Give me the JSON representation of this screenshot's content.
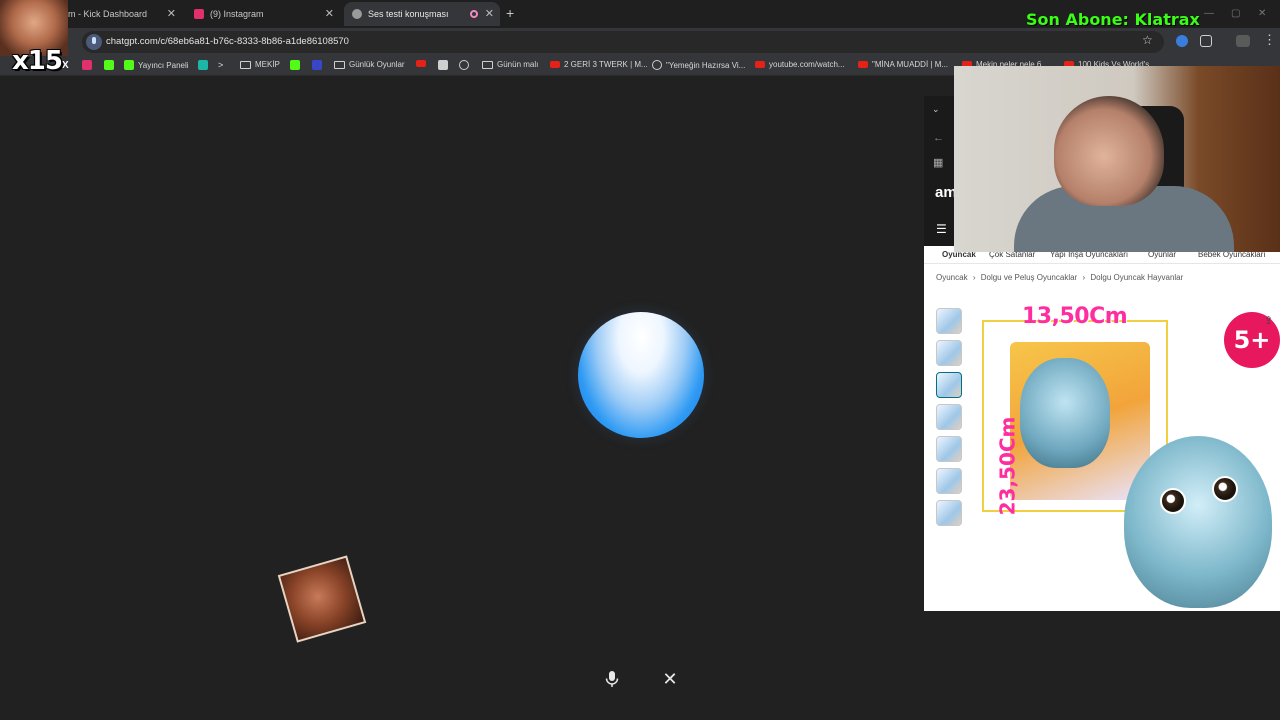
{
  "browser": {
    "tabs": [
      {
        "title": "m - Kick Dashboard",
        "favicon_color": "#53fc18"
      },
      {
        "title": "(9) Instagram",
        "favicon_color": "#e1306c"
      },
      {
        "title": "Ses testi konuşması",
        "favicon_color": "#bbbbbb"
      }
    ],
    "url": "chatgpt.com/c/68eb6a81-b76c-8333-8b86-a1de86108570",
    "bookmarks": [
      {
        "label": "",
        "icon": "x-icon"
      },
      {
        "label": "",
        "icon": "instagram-icon"
      },
      {
        "label": "",
        "icon": "kick-icon"
      },
      {
        "label": "Yayıncı Paneli",
        "icon": "kick-icon"
      },
      {
        "label": "",
        "icon": "app-icon"
      },
      {
        "label": "",
        "icon": "terminal-icon"
      },
      {
        "label": "MEKİP",
        "icon": "folder-icon"
      },
      {
        "label": "",
        "icon": "kick-icon"
      },
      {
        "label": "",
        "icon": "app-icon"
      },
      {
        "label": "Günlük Oyunlar",
        "icon": "folder-icon"
      },
      {
        "label": "",
        "icon": "youtube-icon"
      },
      {
        "label": "",
        "icon": "image-icon"
      },
      {
        "label": "",
        "icon": "globe-icon"
      },
      {
        "label": "Günün malı",
        "icon": "folder-icon"
      },
      {
        "label": "2 GERİ 3 TWERK | M...",
        "icon": "youtube-icon"
      },
      {
        "label": "\"Yemeğin Hazırsa Vi...",
        "icon": "globe-icon"
      },
      {
        "label": "youtube.com/watch...",
        "icon": "youtube-icon"
      },
      {
        "label": "\"MİNA MUADDİ | M...",
        "icon": "youtube-icon"
      },
      {
        "label": "Mekin neler nele 6...",
        "icon": "youtube-icon"
      },
      {
        "label": "100 Kids Vs World's...",
        "icon": "youtube-icon"
      }
    ]
  },
  "overlays": {
    "multiplier": "x15",
    "subscriber_banner": "Son Abone: Klatrax"
  },
  "amazon": {
    "logo": "am",
    "nav": [
      "Oyuncak",
      "Çok Satanlar",
      "Yapı İnşa Oyuncakları",
      "Oyunlar",
      "Bebek Oyuncakları"
    ],
    "breadcrumb": [
      "Oyuncak",
      "›",
      "Dolgu ve Peluş Oyuncaklar",
      "›",
      "Dolgu Oyuncak Hayvanlar"
    ],
    "product": {
      "width_label": "13,50Cm",
      "height_label": "23,50Cm",
      "age_badge": "5+",
      "thumbnail_count": 7
    }
  },
  "colors": {
    "background": "#212121",
    "subscriber_text": "#39ff14",
    "dimension_text": "#ff2ea0",
    "age_badge": "#e8185e"
  }
}
